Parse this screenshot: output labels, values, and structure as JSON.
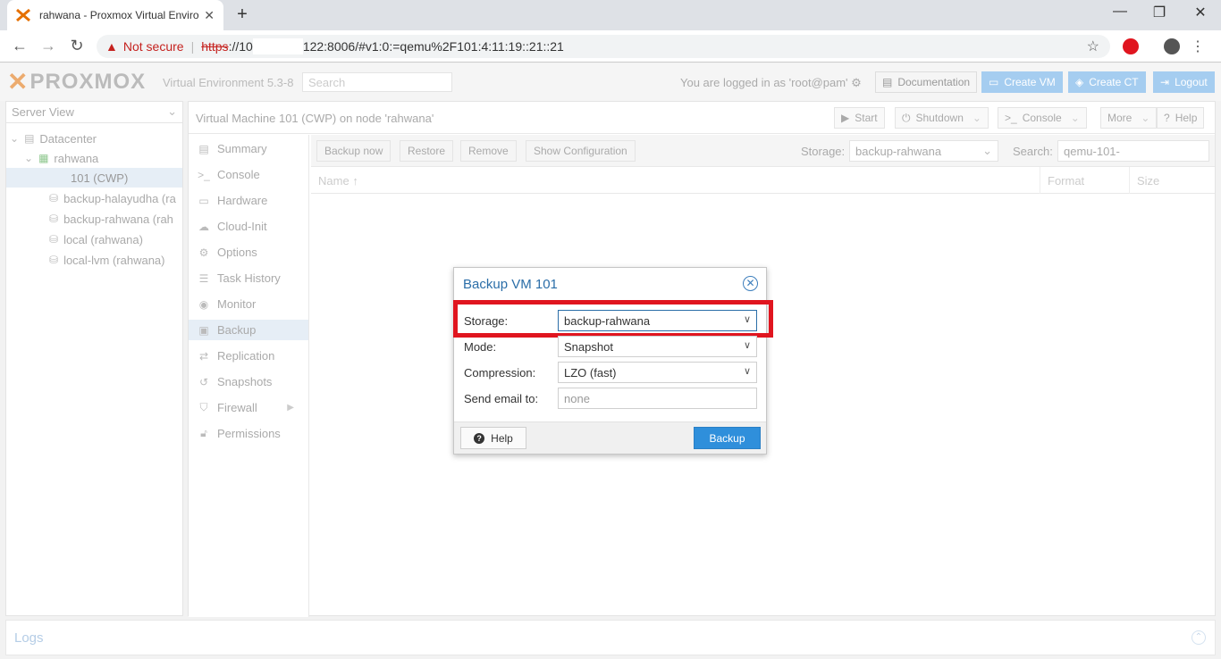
{
  "browser": {
    "tab_title": "rahwana - Proxmox Virtual Enviro",
    "not_secure": "Not secure",
    "scheme": "https",
    "url_part1": "://10",
    "url_part2": "122:8006/#v1:0:=qemu%2F101:4:11:19::21::21"
  },
  "header": {
    "logo_text": "PROXMOX",
    "version": "Virtual Environment 5.3-8",
    "search_placeholder": "Search",
    "logged_in": "You are logged in as 'root@pam'",
    "documentation": "Documentation",
    "create_vm": "Create VM",
    "create_ct": "Create CT",
    "logout": "Logout"
  },
  "tree": {
    "view": "Server View",
    "datacenter": "Datacenter",
    "node": "rahwana",
    "vm": "101 (CWP)",
    "storages": [
      "backup-halayudha (ra",
      "backup-rahwana (rah",
      "local (rahwana)",
      "local-lvm (rahwana)"
    ]
  },
  "content": {
    "title": "Virtual Machine 101 (CWP) on node 'rahwana'",
    "start": "Start",
    "shutdown": "Shutdown",
    "console": "Console",
    "more": "More",
    "help": "Help"
  },
  "nav": [
    {
      "label": "Summary",
      "icon": "book-icon"
    },
    {
      "label": "Console",
      "icon": "terminal-icon"
    },
    {
      "label": "Hardware",
      "icon": "desktop-icon"
    },
    {
      "label": "Cloud-Init",
      "icon": "cloud-icon"
    },
    {
      "label": "Options",
      "icon": "gear-icon"
    },
    {
      "label": "Task History",
      "icon": "list-icon"
    },
    {
      "label": "Monitor",
      "icon": "eye-icon"
    },
    {
      "label": "Backup",
      "icon": "floppy-icon"
    },
    {
      "label": "Replication",
      "icon": "retweet-icon"
    },
    {
      "label": "Snapshots",
      "icon": "history-icon"
    },
    {
      "label": "Firewall",
      "icon": "shield-icon"
    },
    {
      "label": "Permissions",
      "icon": "unlock-icon"
    }
  ],
  "backup_toolbar": {
    "backup_now": "Backup now",
    "restore": "Restore",
    "remove": "Remove",
    "show_config": "Show Configuration",
    "storage_label": "Storage:",
    "storage_value": "backup-rahwana",
    "search_label": "Search:",
    "search_value": "qemu-101-"
  },
  "grid": {
    "col_name": "Name",
    "col_format": "Format",
    "col_size": "Size"
  },
  "logs": {
    "title": "Logs"
  },
  "dialog": {
    "title": "Backup VM 101",
    "storage_label": "Storage:",
    "storage_value": "backup-rahwana",
    "mode_label": "Mode:",
    "mode_value": "Snapshot",
    "compression_label": "Compression:",
    "compression_value": "LZO (fast)",
    "email_label": "Send email to:",
    "email_placeholder": "none",
    "help": "Help",
    "backup": "Backup"
  },
  "colors": {
    "accent": "#2f8fdb",
    "highlight": "#e0151f",
    "logo_orange": "#e57000"
  }
}
